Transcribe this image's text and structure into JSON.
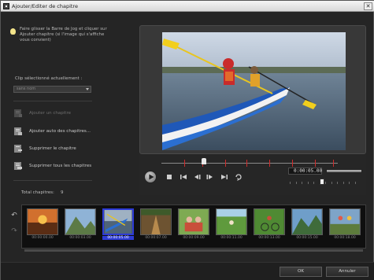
{
  "window": {
    "title": "Ajouter/Editer de chapitre",
    "close_label": "✕"
  },
  "tip": {
    "text": "Faire glisser la Barre de Jog et cliquer sur Ajouter chapitre (si l'image qui s'affiche vous convient)"
  },
  "clip": {
    "label": "Clip sélectionné actuellement :",
    "selected_value": "sans nom"
  },
  "actions": {
    "add_chapter": "Ajouter un chapitre",
    "auto_add_chapters": "Ajouter auto des chapitres...",
    "delete_chapter": "Supprimer le chapitre",
    "delete_all_chapters": "Supprimer tous les chapitres"
  },
  "total": {
    "label": "Total chapitres:",
    "value": "9"
  },
  "player": {
    "timecode": "0:00:05.00"
  },
  "thumbnails": [
    {
      "time": "00:00:00.00",
      "scene": "sunset"
    },
    {
      "time": "00:00:03.00",
      "scene": "mountain"
    },
    {
      "time": "00:00:05.00",
      "scene": "kayak",
      "selected": true
    },
    {
      "time": "00:00:07.00",
      "scene": "path"
    },
    {
      "time": "00:00:09.00",
      "scene": "group"
    },
    {
      "time": "00:00:11.00",
      "scene": "meadow"
    },
    {
      "time": "00:00:13.00",
      "scene": "bike"
    },
    {
      "time": "00:00:15.00",
      "scene": "mountain2"
    },
    {
      "time": "00:00:18.00",
      "scene": "hikers"
    }
  ],
  "footer": {
    "ok_label": "OK",
    "cancel_label": "Annuler"
  },
  "colors": {
    "accent": "#2d3bd6",
    "chapter_marker": "#d12b2b"
  }
}
